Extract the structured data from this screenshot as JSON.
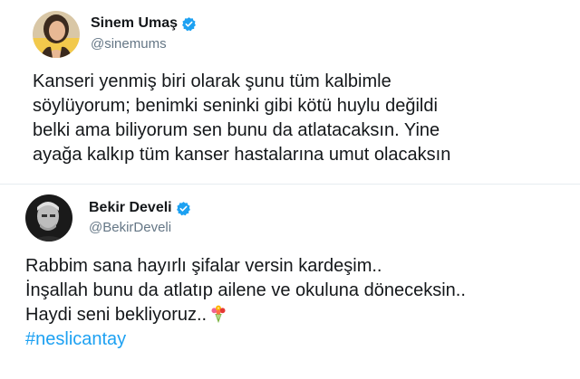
{
  "tweets": [
    {
      "display_name": "Sinem Umaş",
      "handle": "@sinemums",
      "verified": true,
      "avatar_icon": "user-avatar-photo",
      "lines": [
        "Kanseri yenmiş biri olarak şunu tüm kalbimle",
        "söylüyorum; benimki seninki gibi kötü huylu değildi",
        "belki ama biliyorum sen bunu da atlatacaksın. Yine",
        "ayağa kalkıp tüm kanser hastalarına umut olacaksın"
      ]
    },
    {
      "display_name": "Bekir Develi",
      "handle": "@BekirDeveli",
      "verified": true,
      "avatar_icon": "user-avatar-photo",
      "lines": [
        "Rabbim sana hayırlı şifalar versin kardeşim..",
        "İnşallah bunu da atlatıp ailene ve okuluna döneceksin..",
        "Haydi seni bekliyoruz.."
      ],
      "emoji_icon": "bouquet-emoji-icon",
      "hashtag": "#neslicantay"
    }
  ],
  "colors": {
    "text": "#14171a",
    "secondary": "#657786",
    "link": "#1da1f2",
    "divider": "#e6ecf0",
    "verified_badge": "#1da1f2"
  }
}
